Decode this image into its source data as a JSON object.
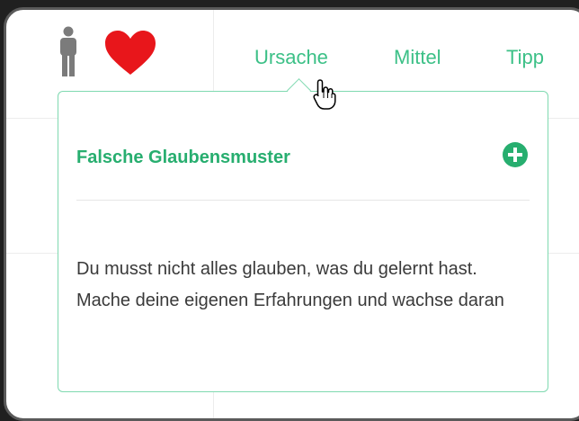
{
  "tabs": [
    {
      "label": "Ursache"
    },
    {
      "label": "Mittel"
    },
    {
      "label": "Tipp"
    }
  ],
  "popover": {
    "title": "Falsche Glaubensmuster",
    "body": "Du musst nicht alles glauben, was du gelernt hast. Mache deine eigenen Erfahrungen und wachse daran"
  },
  "icons": {
    "person": "person-icon",
    "heart": "heart-icon",
    "add": "plus-circle-icon",
    "cursor": "hand-pointer-icon"
  },
  "colors": {
    "accent": "#3cc087",
    "title": "#27ae6f",
    "heart": "#e8161b",
    "person": "#7b7b7b",
    "popover_border": "#7fd9b0"
  }
}
